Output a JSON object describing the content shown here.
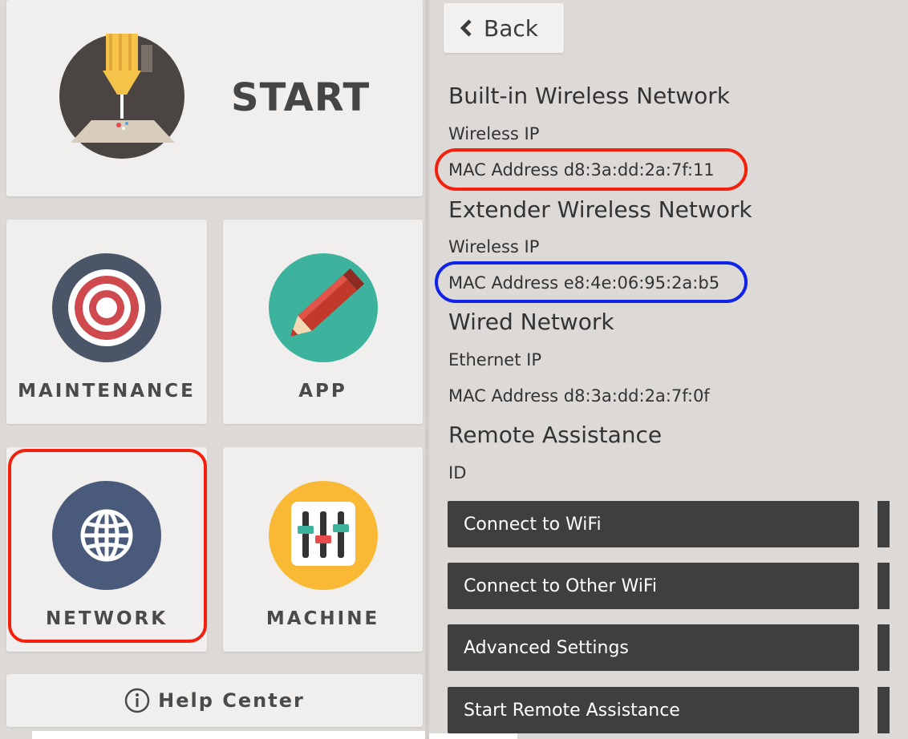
{
  "left": {
    "start_label": "START",
    "tiles": {
      "maintenance": "MAINTENANCE",
      "app": "APP",
      "network": "NETWORK",
      "machine": "MACHINE"
    },
    "help_label": "Help Center"
  },
  "right": {
    "back_label": "Back",
    "sections": {
      "builtin": {
        "title": "Built-in Wireless Network",
        "ip_label": "Wireless IP",
        "mac_line": "MAC Address d8:3a:dd:2a:7f:11"
      },
      "extender": {
        "title": "Extender Wireless Network",
        "ip_label": "Wireless IP",
        "mac_line": "MAC Address e8:4e:06:95:2a:b5"
      },
      "wired": {
        "title": "Wired Network",
        "ip_label": "Ethernet IP",
        "mac_line": "MAC Address d8:3a:dd:2a:7f:0f"
      },
      "remote": {
        "title": "Remote Assistance",
        "id_label": "ID"
      }
    },
    "buttons": {
      "connect_wifi": "Connect to WiFi",
      "connect_other_wifi": "Connect to Other WiFi",
      "advanced_settings": "Advanced Settings",
      "start_remote": "Start Remote Assistance"
    }
  },
  "colors": {
    "highlight_red": "#f4200e",
    "highlight_blue": "#1024e8",
    "button_dark": "#3f3f3f",
    "network_icon_bg": "#4a5a7a",
    "app_icon_bg": "#3db39e",
    "machine_icon_bg": "#f9b934"
  },
  "icons": [
    "printer-nozzle-icon",
    "target-icon",
    "pencil-icon",
    "globe-icon",
    "sliders-icon",
    "info-icon",
    "chevron-left-icon"
  ]
}
